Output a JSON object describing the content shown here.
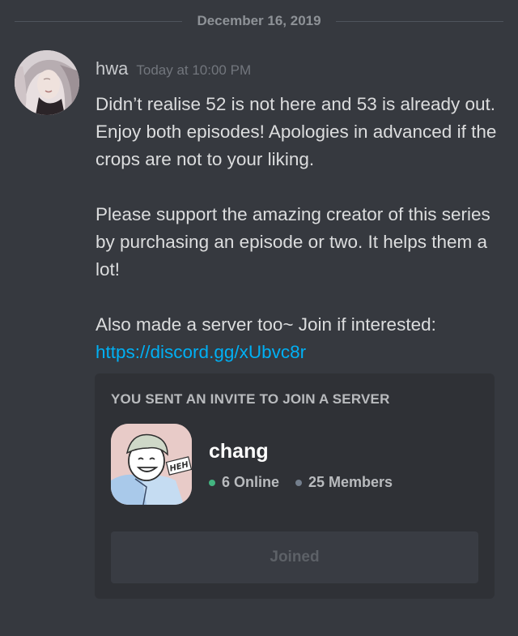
{
  "date_divider": "December 16, 2019",
  "message": {
    "author": "hwa",
    "timestamp": "Today at 10:00 PM",
    "paragraphs": [
      "Didn’t realise 52 is not here and 53 is already out. Enjoy both episodes! Apologies in advanced if the crops are not to your liking.",
      "Please support the amazing creator of this series by purchasing an episode or two. It helps them a lot!",
      "Also made a server too~ Join if interested:"
    ],
    "link": "https://discord.gg/xUbvc8r"
  },
  "invite": {
    "title": "YOU SENT AN INVITE TO JOIN A SERVER",
    "server_name": "chang",
    "online": "6 Online",
    "members": "25 Members",
    "icon_text": "HEH",
    "button_label": "Joined"
  },
  "colors": {
    "background": "#36393f",
    "card": "#2f3136",
    "link": "#00b0f4",
    "online": "#43b581"
  }
}
